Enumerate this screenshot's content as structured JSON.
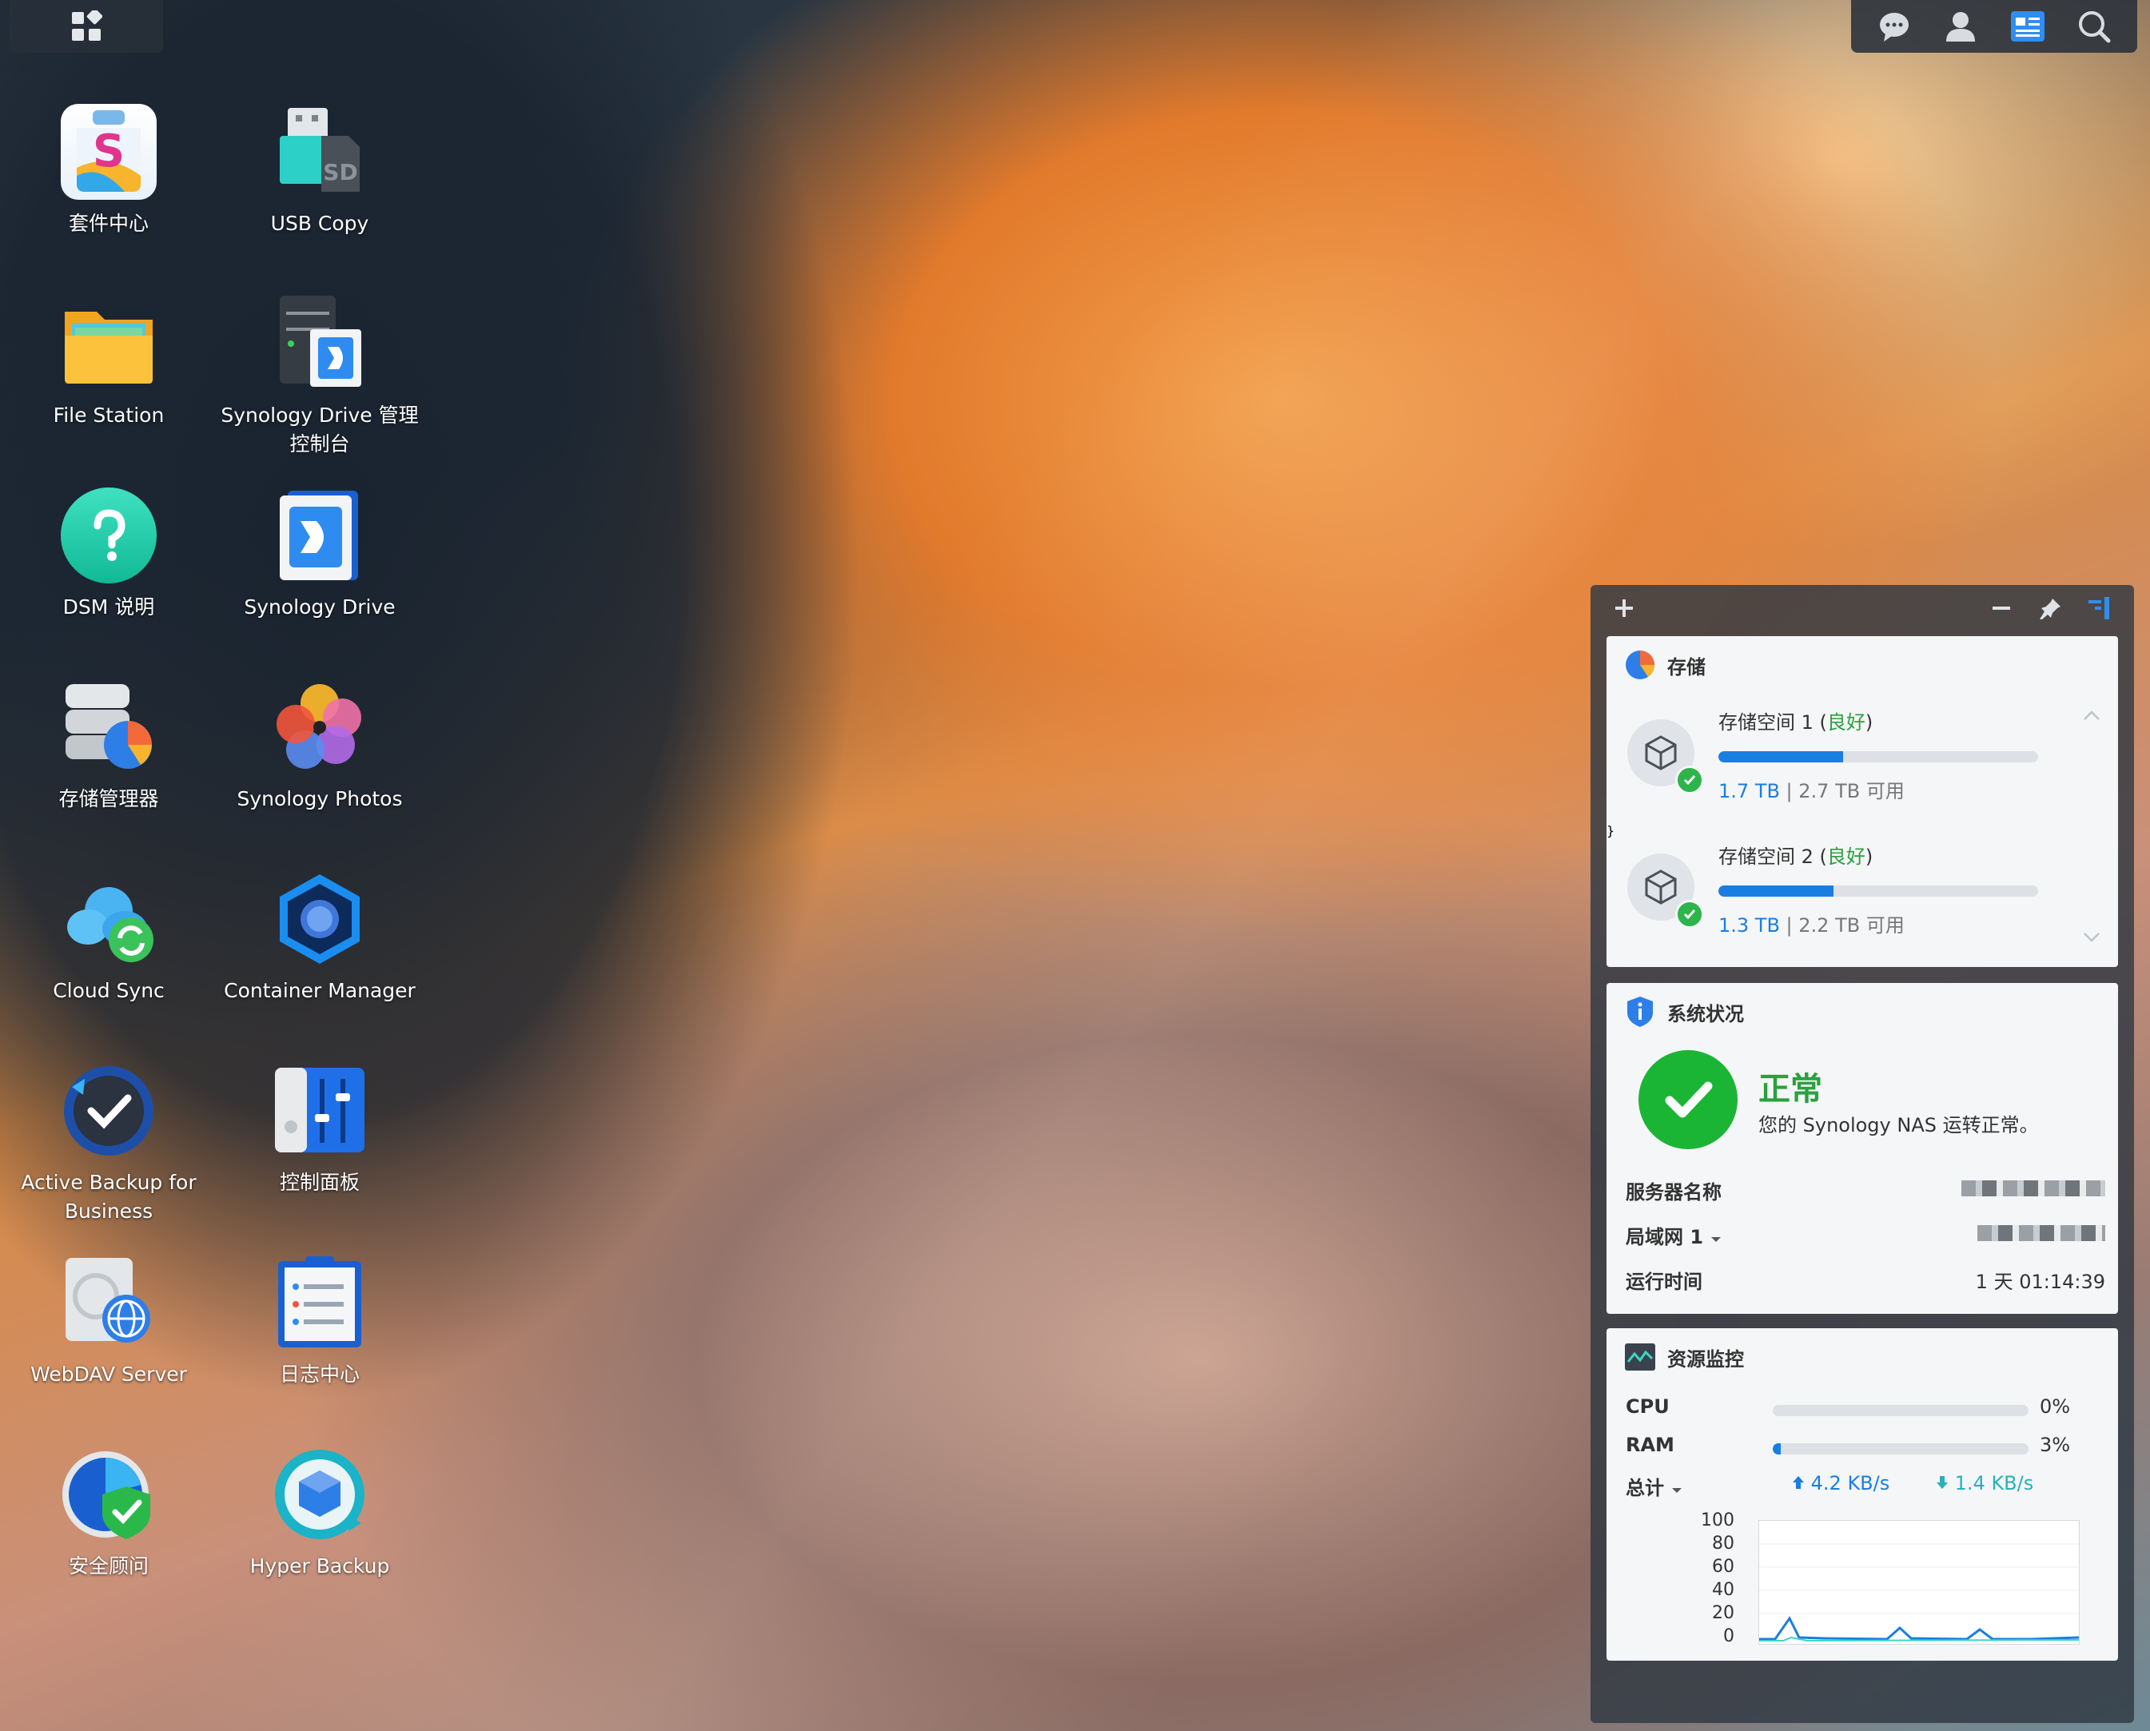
{
  "taskbar": {
    "main_menu_icon": "grid-icon",
    "right_icons": [
      "chat-icon",
      "user-icon",
      "widgets-icon",
      "search-icon"
    ]
  },
  "desktop": {
    "apps": [
      {
        "label": "套件中心",
        "icon": "package-center-icon"
      },
      {
        "label": "USB Copy",
        "icon": "usb-copy-icon"
      },
      {
        "label": "File Station",
        "icon": "folder-icon"
      },
      {
        "label": "Synology Drive 管理控制台",
        "icon": "drive-admin-icon"
      },
      {
        "label": "DSM 说明",
        "icon": "help-icon"
      },
      {
        "label": "Synology Drive",
        "icon": "drive-icon"
      },
      {
        "label": "存储管理器",
        "icon": "storage-manager-icon"
      },
      {
        "label": "Synology Photos",
        "icon": "photos-icon"
      },
      {
        "label": "Cloud Sync",
        "icon": "cloud-sync-icon"
      },
      {
        "label": "Container Manager",
        "icon": "container-icon"
      },
      {
        "label": "Active Backup for Business",
        "icon": "active-backup-icon"
      },
      {
        "label": "控制面板",
        "icon": "control-panel-icon"
      },
      {
        "label": "WebDAV Server",
        "icon": "webdav-icon"
      },
      {
        "label": "日志中心",
        "icon": "log-center-icon"
      },
      {
        "label": "安全顾问",
        "icon": "security-advisor-icon"
      },
      {
        "label": "Hyper Backup",
        "icon": "hyper-backup-icon"
      }
    ]
  },
  "widgets": {
    "toolbar": {
      "add": "+",
      "minimize": "—",
      "pin": "pin-icon",
      "sidebar": "sidebar-icon"
    },
    "storage": {
      "title": "存储",
      "volumes": [
        {
          "name": "存储空间 1 (",
          "status": "良好",
          "close": ")",
          "used": "1.7 TB",
          "sep": " | ",
          "avail": "2.7 TB 可用",
          "fraction": 0.39
        },
        {
          "name": "存储空间 2 (",
          "status": "良好",
          "close": ")",
          "used": "1.3 TB",
          "sep": " | ",
          "avail": "2.2 TB 可用",
          "fraction": 0.36
        }
      ]
    },
    "system": {
      "title": "系统状况",
      "status": "正常",
      "desc": "您的 Synology NAS 运转正常。",
      "server_label": "服务器名称",
      "lan_label": "局域网 1",
      "uptime_label": "运行时间",
      "uptime": "1 天 01:14:39"
    },
    "resource": {
      "title": "资源监控",
      "cpu_label": "CPU",
      "cpu_pct": "0%",
      "cpu_value": 0,
      "ram_label": "RAM",
      "ram_pct": "3%",
      "ram_value": 3,
      "total_label": "总计",
      "up": "4.2 KB/s",
      "down": "1.4 KB/s",
      "y_ticks": [
        "100",
        "80",
        "60",
        "40",
        "20",
        "0"
      ]
    }
  }
}
